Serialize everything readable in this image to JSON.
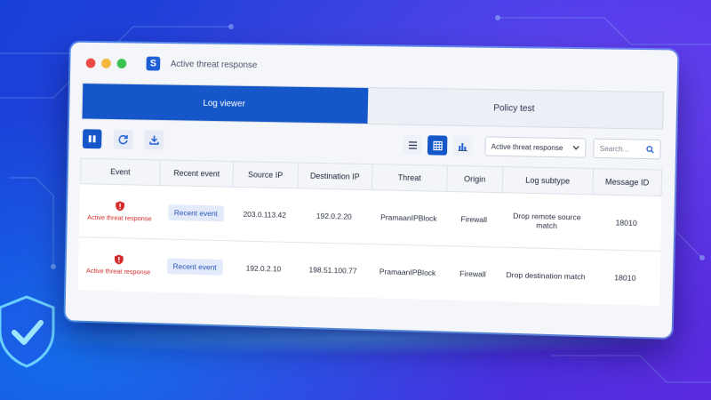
{
  "window": {
    "title": "Active threat response",
    "logo_letter": "S"
  },
  "tabs": [
    {
      "label": "Log viewer",
      "active": true
    },
    {
      "label": "Policy test",
      "active": false
    }
  ],
  "toolbar": {
    "filter_select": "Active threat response",
    "search_placeholder": "Search..."
  },
  "table": {
    "headers": [
      "Event",
      "Recent event",
      "Source IP",
      "Destination IP",
      "Threat",
      "Origin",
      "Log subtype",
      "Message ID"
    ],
    "rows": [
      {
        "event": "Active threat response",
        "recent": "Recent event",
        "source_ip": "203.0.113.42",
        "dest_ip": "192.0.2.20",
        "threat": "PramaanIPBlock",
        "origin": "Firewall",
        "subtype": "Drop remote source match",
        "message_id": "18010"
      },
      {
        "event": "Active threat response",
        "recent": "Recent event",
        "source_ip": "192.0.2.10",
        "dest_ip": "198.51.100.77",
        "threat": "PramaanIPBlock",
        "origin": "Firewall",
        "subtype": "Drop destination match",
        "message_id": "18010"
      }
    ]
  },
  "colors": {
    "accent": "#1557c9",
    "alert": "#d42a2a"
  }
}
